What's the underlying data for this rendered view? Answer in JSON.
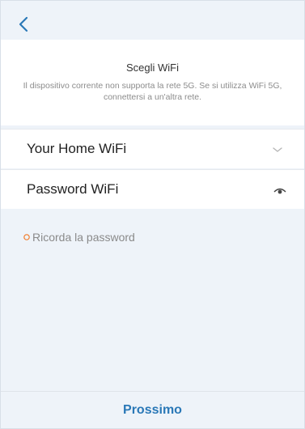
{
  "header": {
    "back_icon": "chevron-left-icon",
    "title": "Scegli WiFi",
    "subtitle": "Il dispositivo corrente non supporta la rete 5G. Se si utilizza WiFi 5G, connettersi a un'altra rete."
  },
  "form": {
    "ssid_value": "Your Home WiFi",
    "ssid_icon": "chevron-down-icon",
    "password_placeholder": "Password WiFi",
    "password_icon": "eye-icon",
    "remember_label": "Ricorda la password",
    "remember_icon": "radio-unchecked-icon"
  },
  "footer": {
    "next_label": "Prossimo"
  },
  "colors": {
    "accent": "#2a78b7",
    "background": "#eef3f9",
    "radio": "#f07a2a"
  }
}
